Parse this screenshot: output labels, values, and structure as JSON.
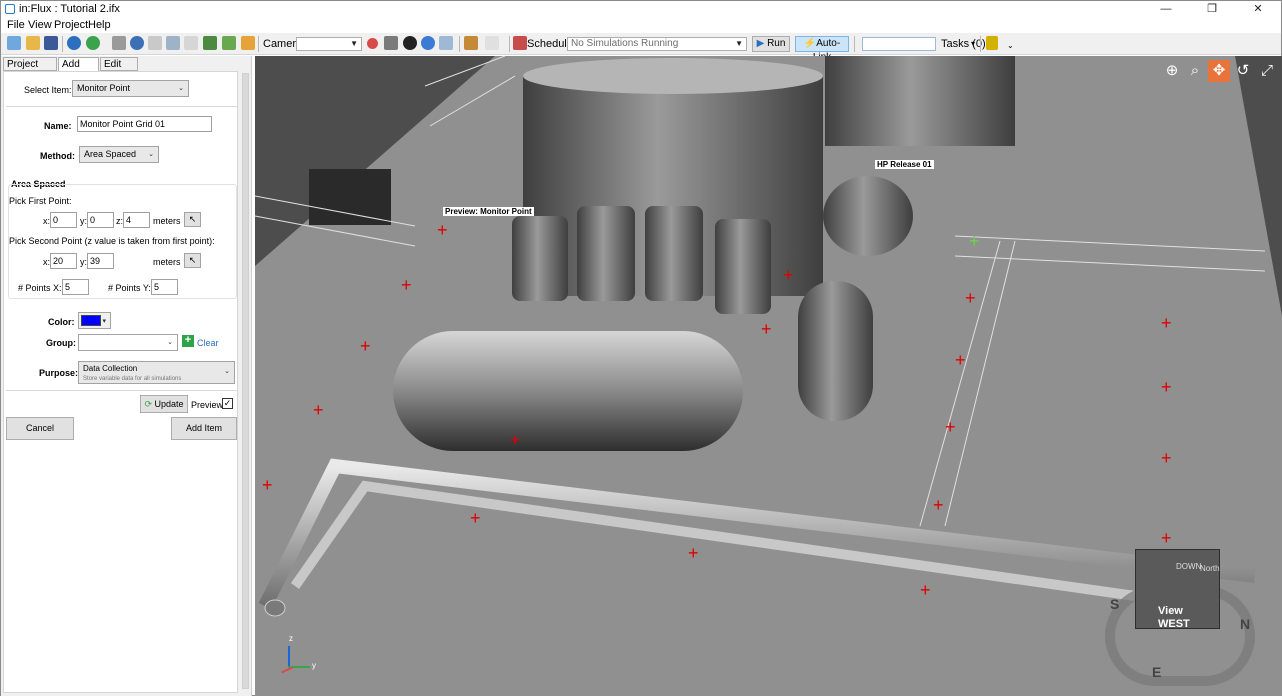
{
  "window": {
    "title": "in:Flux : Tutorial 2.ifx",
    "min": "—",
    "max": "❐",
    "close": "✕"
  },
  "menu": [
    "File",
    "View",
    "Project",
    "Help"
  ],
  "toolbar": {
    "camera_label": "Camera:",
    "camera_value": "",
    "schedule_label": "Schedule:",
    "schedule_value": "No Simulations Running",
    "run_label": "Run",
    "autolink_label": "Auto-Link",
    "tasks_label": "Tasks (0)"
  },
  "tabs": [
    "Project Items",
    "Add Item",
    "Edit Item"
  ],
  "form": {
    "select_item_label": "Select Item:",
    "select_item_value": "Monitor Point",
    "name_label": "Name:",
    "name_value": "Monitor Point Grid 01",
    "method_label": "Method:",
    "method_value": "Area Spaced",
    "area_spaced_heading": "Area Spaced",
    "pick_first_label": "Pick First Point:",
    "first": {
      "x_label": "x:",
      "x": "0",
      "y_label": "y:",
      "y": "0",
      "z_label": "z:",
      "z": "4",
      "units": "meters"
    },
    "pick_second_label": "Pick Second Point (z value is taken from first point):",
    "second": {
      "x_label": "x:",
      "x": "20",
      "y_label": "y:",
      "y": "39",
      "units": "meters"
    },
    "points_x_label": "# Points X:",
    "points_x": "5",
    "points_y_label": "# Points Y:",
    "points_y": "5",
    "color_label": "Color:",
    "color_value": "#0000ff",
    "group_label": "Group:",
    "group_value": "",
    "clear_label": "Clear",
    "purpose_label": "Purpose:",
    "purpose_title": "Data Collection",
    "purpose_sub": "Store variable data for all simulations",
    "update_label": "Update",
    "preview_label": "Preview",
    "preview_checked": "✓",
    "cancel_label": "Cancel",
    "add_item_label": "Add Item"
  },
  "viewport": {
    "preview_label": "Preview: Monitor Point",
    "release_label": "HP Release 01",
    "cube_top": "View",
    "cube_face": "WEST",
    "cube_side": "DOWN",
    "cube_side2": "North",
    "compass_s": "S",
    "compass_n": "N",
    "compass_e": "E",
    "axis_z": "z",
    "axis_y": "y"
  }
}
